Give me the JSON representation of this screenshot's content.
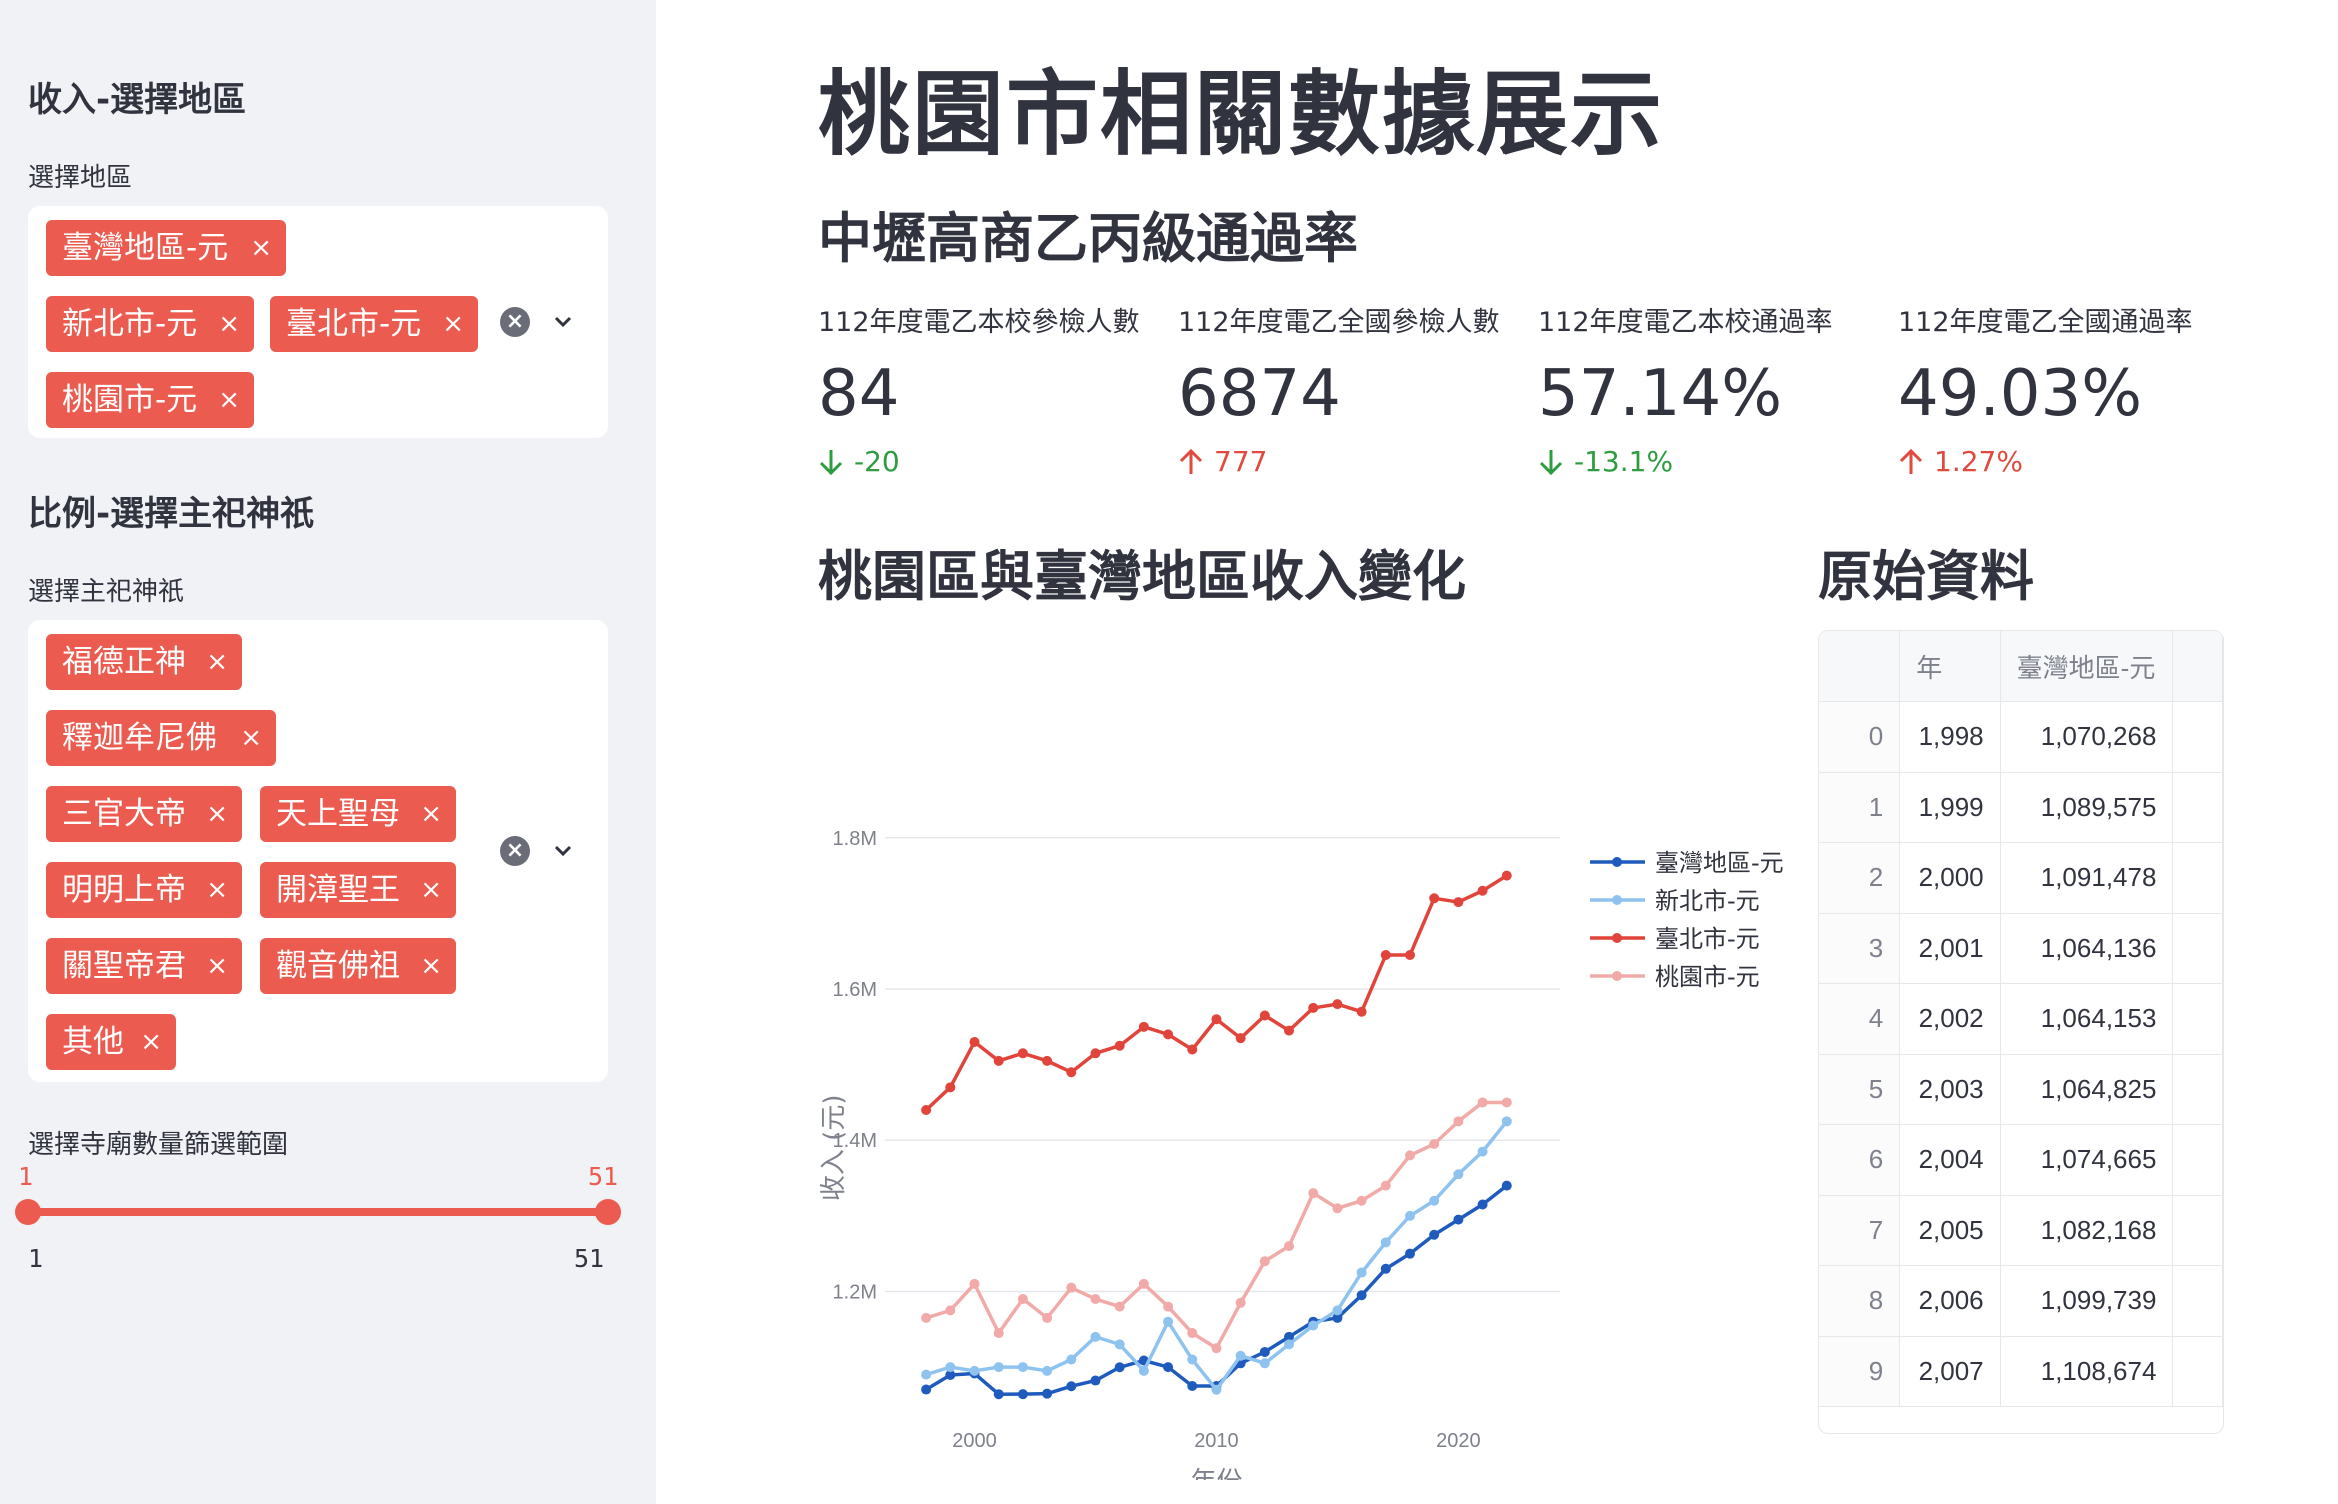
{
  "sidebar": {
    "income_header": "收入-選擇地區",
    "region_label": "選擇地區",
    "region_tags": [
      "臺灣地區-元",
      "新北市-元",
      "臺北市-元",
      "桃園市-元"
    ],
    "ratio_header": "比例-選擇主祀神祇",
    "deity_label": "選擇主祀神祇",
    "deity_tags": [
      "福德正神",
      "釋迦牟尼佛",
      "三官大帝",
      "天上聖母",
      "明明上帝",
      "開漳聖王",
      "關聖帝君",
      "觀音佛祖",
      "其他"
    ],
    "tag_remove": "×",
    "slider_label": "選擇寺廟數量篩選範圍",
    "slider_min": "1",
    "slider_max": "51",
    "slider_range_min": "1",
    "slider_range_max": "51"
  },
  "main": {
    "title": "桃園市相關數據展示",
    "subtitle": "中壢高商乙丙級通過率",
    "metrics": [
      {
        "label": "112年度電乙本校參檢人數",
        "value": "84",
        "delta": "-20",
        "direction": "down"
      },
      {
        "label": "112年度電乙全國參檢人數",
        "value": "6874",
        "delta": "777",
        "direction": "up"
      },
      {
        "label": "112年度電乙本校通過率",
        "value": "57.14%",
        "delta": "-13.1%",
        "direction": "down"
      },
      {
        "label": "112年度電乙全國通過率",
        "value": "49.03%",
        "delta": "1.27%",
        "direction": "up"
      }
    ],
    "chart_title": "桃園區與臺灣地區收入變化",
    "table_title": "原始資料"
  },
  "table": {
    "columns": [
      "",
      "年",
      "臺灣地區-元"
    ],
    "rows": [
      [
        "0",
        "1,998",
        "1,070,268"
      ],
      [
        "1",
        "1,999",
        "1,089,575"
      ],
      [
        "2",
        "2,000",
        "1,091,478"
      ],
      [
        "3",
        "2,001",
        "1,064,136"
      ],
      [
        "4",
        "2,002",
        "1,064,153"
      ],
      [
        "5",
        "2,003",
        "1,064,825"
      ],
      [
        "6",
        "2,004",
        "1,074,665"
      ],
      [
        "7",
        "2,005",
        "1,082,168"
      ],
      [
        "8",
        "2,006",
        "1,099,739"
      ],
      [
        "9",
        "2,007",
        "1,108,674"
      ]
    ]
  },
  "colors": {
    "accent": "#eb5b4f",
    "delta_down": "#2e9c40",
    "delta_up": "#e04a3f"
  },
  "chart_data": {
    "type": "line",
    "xlabel": "年份",
    "ylabel": "收入 (元)",
    "x_ticks": [
      "2000",
      "2010",
      "2020"
    ],
    "y_ticks": [
      "1.2M",
      "1.4M",
      "1.6M",
      "1.8M"
    ],
    "xlim": [
      1996.3,
      2024.2
    ],
    "ylim": [
      1030000,
      1850000
    ],
    "legend_position": "right",
    "x": [
      1998,
      1999,
      2000,
      2001,
      2002,
      2003,
      2004,
      2005,
      2006,
      2007,
      2008,
      2009,
      2010,
      2011,
      2012,
      2013,
      2014,
      2015,
      2016,
      2017,
      2018,
      2019,
      2020,
      2021,
      2022
    ],
    "series": [
      {
        "name": "臺灣地區-元",
        "color": "#1f5bbd",
        "values": [
          1070268,
          1089575,
          1091478,
          1064136,
          1064153,
          1064825,
          1074665,
          1082168,
          1099739,
          1108674,
          1100000,
          1075000,
          1075000,
          1105000,
          1120000,
          1140000,
          1160000,
          1165000,
          1195000,
          1230000,
          1250000,
          1275000,
          1295000,
          1315000,
          1340000
        ]
      },
      {
        "name": "新北市-元",
        "color": "#8ec3f0",
        "values": [
          1090000,
          1100000,
          1095000,
          1100000,
          1100000,
          1095000,
          1110000,
          1140000,
          1130000,
          1095000,
          1160000,
          1110000,
          1070000,
          1115000,
          1105000,
          1130000,
          1155000,
          1175000,
          1225000,
          1265000,
          1300000,
          1320000,
          1355000,
          1385000,
          1425000
        ]
      },
      {
        "name": "臺北市-元",
        "color": "#e0443a",
        "values": [
          1440000,
          1470000,
          1530000,
          1505000,
          1515000,
          1505000,
          1490000,
          1515000,
          1525000,
          1550000,
          1540000,
          1520000,
          1560000,
          1535000,
          1565000,
          1545000,
          1575000,
          1580000,
          1570000,
          1645000,
          1645000,
          1720000,
          1715000,
          1730000,
          1750000
        ]
      },
      {
        "name": "桃園市-元",
        "color": "#f2aaa8",
        "values": [
          1165000,
          1175000,
          1210000,
          1145000,
          1190000,
          1165000,
          1205000,
          1190000,
          1180000,
          1210000,
          1180000,
          1145000,
          1125000,
          1185000,
          1240000,
          1260000,
          1330000,
          1310000,
          1320000,
          1340000,
          1380000,
          1395000,
          1425000,
          1450000,
          1450000
        ]
      }
    ]
  }
}
